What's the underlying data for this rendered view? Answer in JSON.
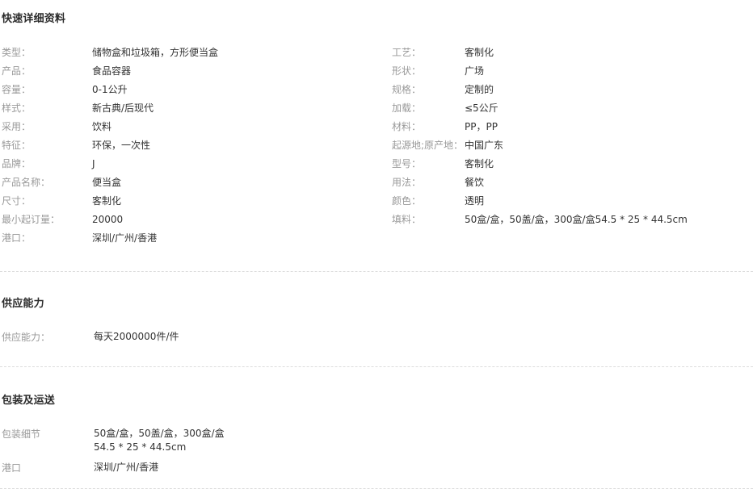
{
  "quick_details": {
    "title": "快速详细资料",
    "left_rows": [
      {
        "label": "类型：",
        "value": "储物盒和垃圾箱，方形便当盒"
      },
      {
        "label": "产品：",
        "value": "食品容器"
      },
      {
        "label": "容量：",
        "value": "0-1公升"
      },
      {
        "label": "样式：",
        "value": "新古典/后现代"
      },
      {
        "label": "采用：",
        "value": "饮料"
      },
      {
        "label": "特征：",
        "value": "环保，一次性"
      },
      {
        "label": "品牌：",
        "value": "J"
      },
      {
        "label": "产品名称：",
        "value": "便当盒"
      },
      {
        "label": "尺寸：",
        "value": "客制化"
      },
      {
        "label": "最小起订量：",
        "value": "20000"
      },
      {
        "label": "港口：",
        "value": "深圳/广州/香港"
      }
    ],
    "right_rows": [
      {
        "label": "工艺：",
        "value": "客制化"
      },
      {
        "label": "形状：",
        "value": "广场"
      },
      {
        "label": "规格：",
        "value": "定制的"
      },
      {
        "label": "加载：",
        "value": "≤5公斤"
      },
      {
        "label": "材料：",
        "value": "PP，PP"
      },
      {
        "label": "起源地;原产地：",
        "value": "中国广东"
      },
      {
        "label": "型号：",
        "value": "客制化"
      },
      {
        "label": "用法：",
        "value": "餐饮"
      },
      {
        "label": "颜色：",
        "value": "透明"
      },
      {
        "label": "填料：",
        "value": "50盒/盒，50盖/盒，300盒/盒54.5 * 25 * 44.5cm"
      }
    ]
  },
  "supply_ability": {
    "title": "供应能力",
    "rows": [
      {
        "label": "供应能力：",
        "value": "每天2000000件/件"
      }
    ]
  },
  "packaging_delivery": {
    "title": "包装及运送",
    "rows": [
      {
        "label": "包装细节",
        "value": "50盒/盒，50盖/盒，300盒/盒\n54.5 * 25 * 44.5cm"
      },
      {
        "label": "港口",
        "value": "深圳/广州/香港"
      }
    ]
  },
  "theme": {
    "label_color": "#999999",
    "value_color": "#333333",
    "title_color": "#2b2b2b",
    "divider_color": "#dcdcdc",
    "background": "#ffffff"
  }
}
